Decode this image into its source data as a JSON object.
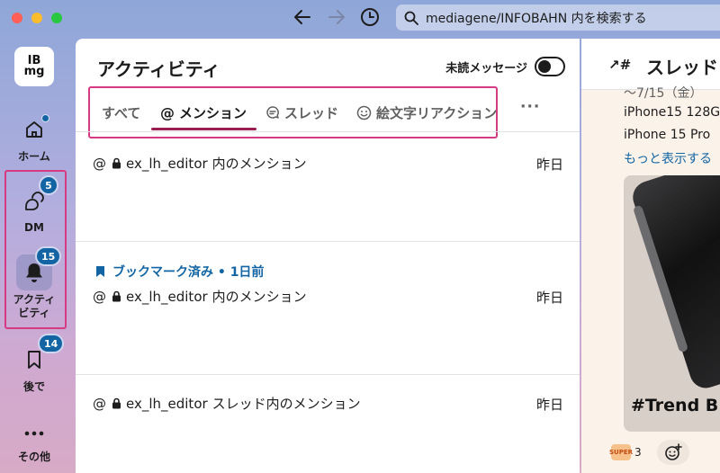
{
  "search": {
    "placeholder": "mediagene/INFOBAHN 内を検索する"
  },
  "workspace": {
    "logo_line1": "IB",
    "logo_line2": "mg"
  },
  "sidebar": {
    "items": [
      {
        "label": "ホーム",
        "badge": null
      },
      {
        "label": "DM",
        "badge": "5"
      },
      {
        "label": "アクティビティ",
        "label_line1": "アクティ",
        "label_line2": "ビティ",
        "badge": "15"
      },
      {
        "label": "後で",
        "badge": "14"
      },
      {
        "label": "その他",
        "badge": null
      }
    ]
  },
  "activity": {
    "title": "アクティビティ",
    "unread_label": "未読メッセージ",
    "tabs": [
      {
        "label": "すべて"
      },
      {
        "label": "メンション",
        "active": true
      },
      {
        "label": "スレッド"
      },
      {
        "label": "絵文字リアクション"
      }
    ],
    "more_label": "···",
    "rows": [
      {
        "channel": "ex_lh_editor",
        "text": "内のメンション",
        "date": "昨日",
        "bookmark": null
      },
      {
        "channel": "ex_lh_editor",
        "text": "内のメンション",
        "date": "昨日",
        "bookmark": "ブックマーク済み • 1日前"
      },
      {
        "channel": "ex_lh_editor",
        "text": "スレッド内のメンション",
        "date": "昨日",
        "bookmark": null
      }
    ]
  },
  "thread": {
    "title": "スレッド",
    "line1": "〜7/15（金）",
    "line2": "iPhone15 128G",
    "line3": "iPhone 15 Pro",
    "more_link": "もっと表示する",
    "image_caption": "#Trend B",
    "reaction_emoji": "SUPER",
    "reaction_count": "3"
  },
  "colors": {
    "accent": "#1264a3",
    "highlight": "#d63a82",
    "tab_underline": "#9c1d52"
  }
}
